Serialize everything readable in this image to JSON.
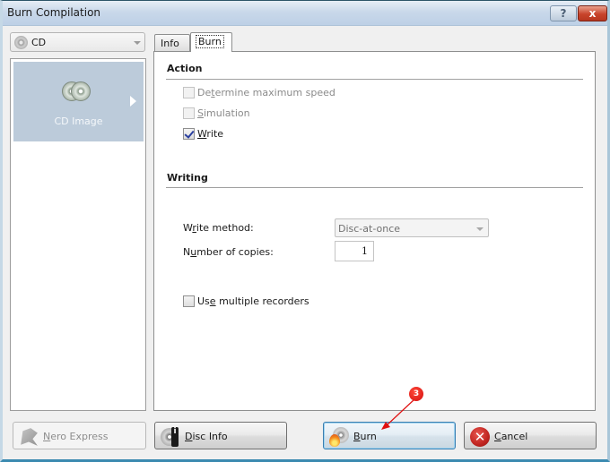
{
  "window": {
    "title": "Burn Compilation",
    "help_label": "?",
    "close_label": "x"
  },
  "media": {
    "selected": "CD",
    "icon": "cd-disc-icon"
  },
  "project_list": {
    "items": [
      {
        "label": "CD Image",
        "icon": "cd-image-icon",
        "selected": true
      }
    ]
  },
  "tabs": [
    {
      "label": "Info",
      "active": false
    },
    {
      "label": "Burn",
      "active": true
    }
  ],
  "burn_tab": {
    "action": {
      "title": "Action",
      "options": [
        {
          "pre": "De",
          "key": "t",
          "post": "ermine maximum speed",
          "checked": false,
          "enabled": false
        },
        {
          "pre": "",
          "key": "S",
          "post": "imulation",
          "checked": false,
          "enabled": false
        },
        {
          "pre": "",
          "key": "W",
          "post": "rite",
          "checked": true,
          "enabled": true
        }
      ]
    },
    "writing": {
      "title": "Writing",
      "write_method_label_pre": "W",
      "write_method_label_key": "r",
      "write_method_label_post": "ite method:",
      "write_method_value": "Disc-at-once",
      "copies_label_pre": "N",
      "copies_label_key": "u",
      "copies_label_post": "mber of copies:",
      "copies_value": "1",
      "multi_pre": "Us",
      "multi_key": "e",
      "multi_post": " multiple recorders",
      "multi_checked": false
    }
  },
  "buttons": {
    "nero_express": {
      "key": "N",
      "rest": "ero Express",
      "enabled": false
    },
    "disc_info": {
      "key": "D",
      "rest": "isc Info"
    },
    "burn": {
      "key": "B",
      "rest": "urn"
    },
    "cancel": {
      "key": "C",
      "rest": "ancel"
    }
  },
  "annotation": {
    "step": "3",
    "color": "#e01010"
  }
}
